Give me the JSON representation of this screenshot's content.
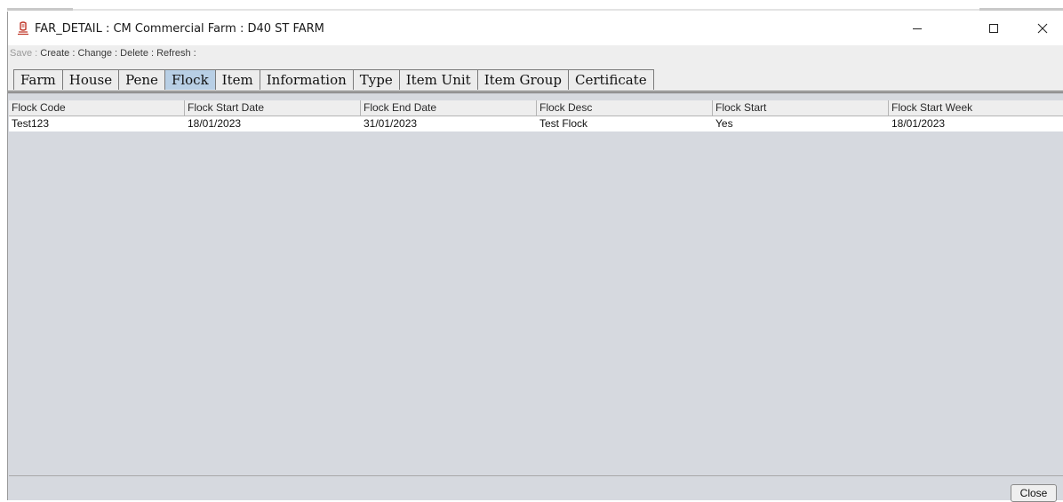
{
  "window": {
    "title": "FAR_DETAIL : CM Commercial Farm : D40 ST FARM"
  },
  "menubar": {
    "save": "Save : ",
    "create": "Create : ",
    "change": "Change : ",
    "delete": "Delete : ",
    "refresh": "Refresh :"
  },
  "tabs": [
    "Farm",
    "House",
    "Pene",
    "Flock",
    "Item",
    "Information",
    "Type",
    "Item Unit",
    "Item Group",
    "Certificate"
  ],
  "active_tab": "Flock",
  "table": {
    "columns": [
      "Flock Code",
      "Flock Start Date",
      "Flock End Date",
      "Flock Desc",
      "Flock Start",
      "Flock Start Week"
    ],
    "rows": [
      [
        "Test123",
        "18/01/2023",
        "31/01/2023",
        "Test Flock",
        "Yes",
        "18/01/2023"
      ]
    ]
  },
  "footer": {
    "close_label": "Close"
  },
  "icons": {
    "app": "farm-app-icon",
    "minimize": "minimize-icon",
    "maximize": "maximize-icon",
    "close": "close-icon"
  },
  "colors": {
    "active_tab": "#b8cfe5",
    "app_icon": "#c0392b"
  }
}
